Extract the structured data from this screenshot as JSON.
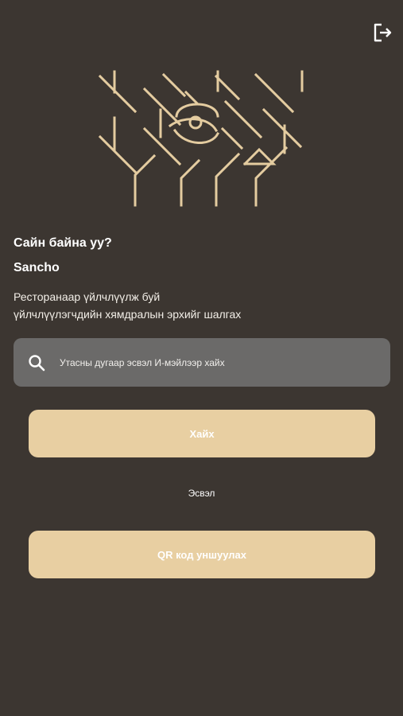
{
  "header": {
    "logout_icon": "logout-icon"
  },
  "brand": {
    "logo_icon": "sancho-logo-icon"
  },
  "greeting": {
    "title": "Сайн байна уу?",
    "name": "Sancho",
    "description_line1": "Ресторанаар үйлчлүүлж буй",
    "description_line2": "үйлчлүүлэгчдийн хямдралын эрхийг шалгах"
  },
  "search": {
    "placeholder": "Утасны дугаар эсвэл И-мэйлээр хайх",
    "value": "",
    "icon": "search-icon"
  },
  "actions": {
    "search_label": "Хайх",
    "or_label": "Эсвэл",
    "qr_label": "QR код уншуулах"
  },
  "colors": {
    "background": "#3c3631",
    "accent": "#e8cfa2",
    "search_box": "#6b6a69",
    "text": "#ffffff"
  }
}
